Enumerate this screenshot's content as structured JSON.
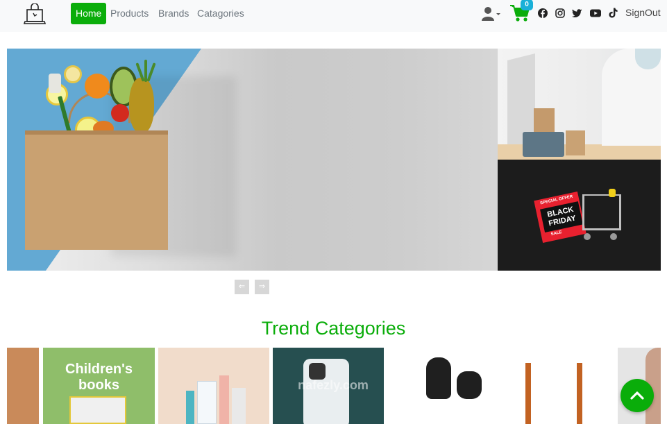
{
  "navbar": {
    "logo_icon": "shopping-bag-laptop-icon",
    "links": [
      {
        "label": "Home",
        "active": true
      },
      {
        "label": "Products",
        "active": false
      },
      {
        "label": "Brands",
        "active": false
      },
      {
        "label": "Catagories",
        "active": false
      }
    ],
    "cart_count": "0",
    "social_icons": [
      "facebook-icon",
      "instagram-icon",
      "twitter-icon",
      "youtube-icon",
      "tiktok-icon"
    ],
    "signout_label": "SignOut",
    "accent_color": "#0aad0a",
    "badge_color": "#1ab0d8"
  },
  "hero": {
    "side_banner_text": "BLACK FRIDAY",
    "side_banner_sub_top": "SPECIAL OFFER",
    "side_banner_sub_bottom": "SALE",
    "prev_arrow": "⇐",
    "next_arrow": "⇒"
  },
  "trend": {
    "title": "Trend Categories",
    "tiles": [
      {
        "label": ""
      },
      {
        "label": "Children's books"
      },
      {
        "label": ""
      },
      {
        "label": ""
      },
      {
        "label": ""
      },
      {
        "label": ""
      }
    ],
    "watermark": "nafezly.com"
  }
}
